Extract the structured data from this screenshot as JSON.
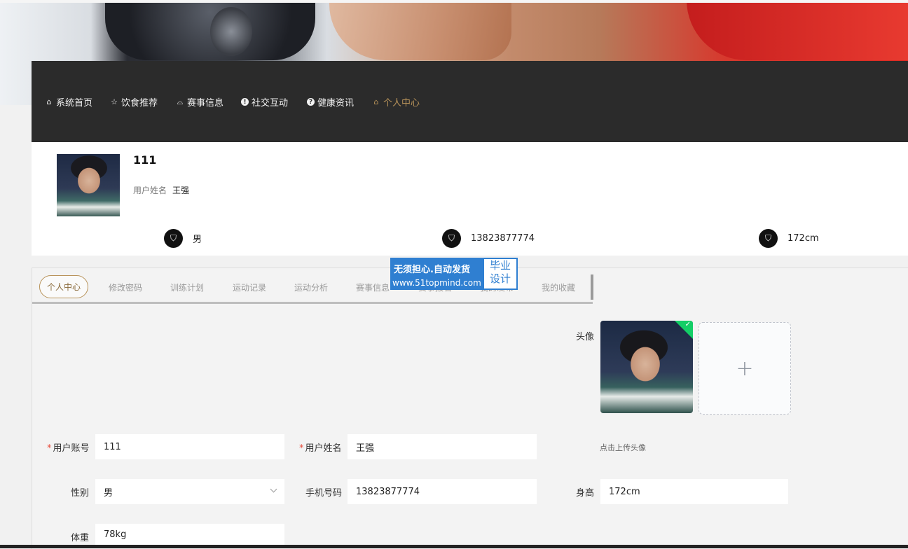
{
  "nav": {
    "items": [
      {
        "label": "系统首页",
        "icon": "home-icon"
      },
      {
        "label": "饮食推荐",
        "icon": "star-icon"
      },
      {
        "label": "赛事信息",
        "icon": "bag-icon"
      },
      {
        "label": "社交互动",
        "icon": "info-icon"
      },
      {
        "label": "健康资讯",
        "icon": "question-icon"
      },
      {
        "label": "个人中心",
        "icon": "home-icon",
        "active": true
      }
    ]
  },
  "profile": {
    "username": "111",
    "realname_label": "用户姓名",
    "realname": "王强",
    "stats": [
      "男",
      "13823877774",
      "172cm"
    ]
  },
  "tabs": [
    "个人中心",
    "修改密码",
    "训练计划",
    "运动记录",
    "运动分析",
    "赛事信息",
    "赛事报名",
    "我的发布",
    "我的收藏"
  ],
  "watermark": {
    "line1": "无须担心.自动发货",
    "line2": "www.51topmind.com",
    "badge1": "毕业",
    "badge2": "设计"
  },
  "form": {
    "avatar_label": "头像",
    "upload_hint": "点击上传头像",
    "account_label": "用户账号",
    "account_value": "111",
    "name_label": "用户姓名",
    "name_value": "王强",
    "gender_label": "性别",
    "gender_value": "男",
    "phone_label": "手机号码",
    "phone_value": "13823877774",
    "height_label": "身高",
    "height_value": "172cm",
    "weight_label": "体重",
    "weight_value": "78kg"
  },
  "colors": {
    "accent": "#b8935a",
    "nav_bg": "#2b2b2b",
    "required": "#e74c3c"
  }
}
